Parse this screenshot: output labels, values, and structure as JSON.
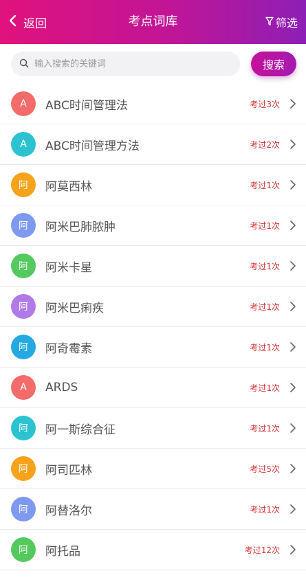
{
  "header": {
    "back_label": "返回",
    "title": "考点词库",
    "filter_label": "筛选"
  },
  "search": {
    "placeholder": "输入搜索的关键词",
    "button_label": "搜索"
  },
  "items": [
    {
      "avatar": "A",
      "avatar_color": "#f36b6b",
      "term": "ABC时间管理法",
      "count": "考过3次"
    },
    {
      "avatar": "A",
      "avatar_color": "#2bc3cf",
      "term": "ABC时间管理方法",
      "count": "考过2次"
    },
    {
      "avatar": "阿",
      "avatar_color": "#f6a21a",
      "term": "阿莫西林",
      "count": "考过1次"
    },
    {
      "avatar": "阿",
      "avatar_color": "#7e99f0",
      "term": "阿米巴肺脓肿",
      "count": "考过1次"
    },
    {
      "avatar": "阿",
      "avatar_color": "#54c95e",
      "term": "阿米卡星",
      "count": "考过1次"
    },
    {
      "avatar": "阿",
      "avatar_color": "#b07be8",
      "term": "阿米巴痢疾",
      "count": "考过1次"
    },
    {
      "avatar": "阿",
      "avatar_color": "#24a9e1",
      "term": "阿奇霉素",
      "count": "考过1次"
    },
    {
      "avatar": "A",
      "avatar_color": "#f36b6b",
      "term": "ARDS",
      "count": "考过1次"
    },
    {
      "avatar": "阿",
      "avatar_color": "#2bc3cf",
      "term": "阿一斯综合征",
      "count": "考过1次"
    },
    {
      "avatar": "阿",
      "avatar_color": "#f6a21a",
      "term": "阿司匹林",
      "count": "考过5次"
    },
    {
      "avatar": "阿",
      "avatar_color": "#7e99f0",
      "term": "阿替洛尔",
      "count": "考过1次"
    },
    {
      "avatar": "阿",
      "avatar_color": "#54c95e",
      "term": "阿托品",
      "count": "考过12次"
    }
  ],
  "icons": {
    "back": "chevron-left-icon",
    "filter": "filter-icon",
    "search": "search-icon",
    "row_arrow": "chevron-right-icon"
  },
  "colors": {
    "header_gradient_start": "#e0127d",
    "header_gradient_end": "#8d1fb6",
    "count_text": "#d4383a"
  }
}
